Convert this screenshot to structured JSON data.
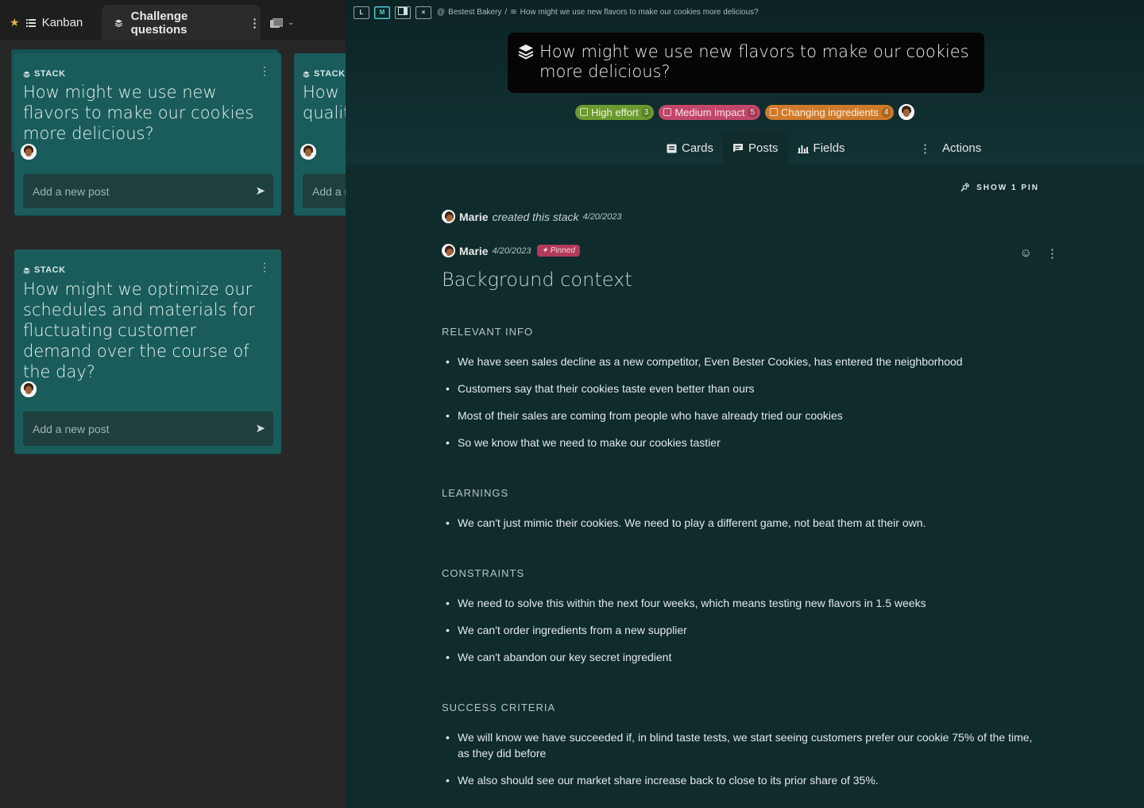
{
  "left_tabs": {
    "kanban_label": "Kanban",
    "active_label": "Challenge questions"
  },
  "cards": [
    {
      "kind": "STACK",
      "title": "How might we use new flavors to make our cookies more delicious?",
      "add_post_placeholder": "Add a new post"
    },
    {
      "kind": "STACK",
      "title": "How might we optimize our schedules and materials for fluctuating customer demand over the course of the day?",
      "add_post_placeholder": "Add a new post"
    },
    {
      "kind": "STACK",
      "title_visible": "How r\nqualit",
      "add_post_visible": "Add a r"
    }
  ],
  "breadcrumb": {
    "workspace": "Bestest Bakery",
    "separator": "/",
    "page": "How might we use new flavors to make our cookies more delicious?"
  },
  "view_buttons": [
    "L",
    "M",
    "",
    "×"
  ],
  "stack_title": "How might we use new flavors to make our cookies more delicious?",
  "tags": [
    {
      "label": "High effort",
      "count": "3",
      "bg": "#6b9a2e",
      "fg": "#eef6df"
    },
    {
      "label": "Medium impact",
      "count": "5",
      "bg": "#c2466a",
      "fg": "#fbe3ea"
    },
    {
      "label": "Changing ingredients",
      "count": "4",
      "bg": "#cf7a2a",
      "fg": "#fdeedd"
    }
  ],
  "nav_tabs": {
    "cards": "Cards",
    "posts": "Posts",
    "fields": "Fields",
    "actions": "Actions"
  },
  "show_pin": "SHOW 1 PIN",
  "created": {
    "author": "Marie",
    "action": "created this stack",
    "date": "4/20/2023"
  },
  "post": {
    "author": "Marie",
    "date": "4/20/2023",
    "badge": "Pinned",
    "heading": "Background context",
    "sections": [
      {
        "title": "RELEVANT INFO",
        "items": [
          "We have seen sales decline as a new competitor, Even Bester Cookies, has entered the neighborhood",
          "Customers say that their cookies taste even better than ours",
          "Most of their sales are coming from people who have already tried our cookies",
          "So we know that we need to make our cookies tastier"
        ]
      },
      {
        "title": "LEARNINGS",
        "items": [
          "We can't just mimic their cookies. We need to play a different game, not beat them at their own."
        ]
      },
      {
        "title": "CONSTRAINTS",
        "items": [
          "We need to solve this within the next four weeks, which means testing new flavors in 1.5 weeks",
          "We can't order ingredients from a new supplier",
          "We can't abandon our key secret ingredient"
        ]
      },
      {
        "title": "SUCCESS CRITERIA",
        "items": [
          "We will know we have succeeded if, in blind taste tests, we start seeing customers prefer our cookie 75% of the time, as they did before",
          "We also should see our market share increase back to close to its prior share of 35%."
        ]
      }
    ]
  }
}
